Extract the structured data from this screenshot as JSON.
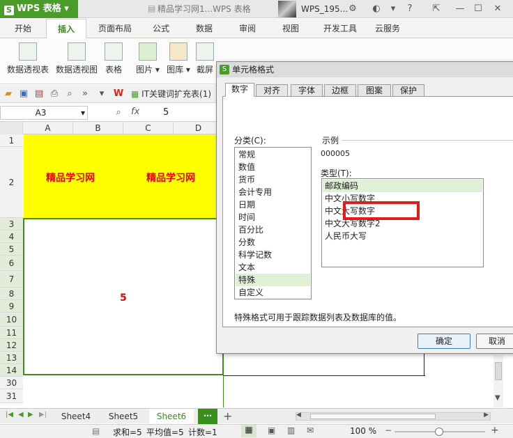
{
  "titlebar": {
    "app_name": "WPS 表格",
    "doc_title": "精品学习网1...WPS 表格",
    "user_name": "WPS_195..."
  },
  "ribbon_tabs": [
    "开始",
    "插入",
    "页面布局",
    "公式",
    "数据",
    "审阅",
    "视图",
    "开发工具",
    "云服务"
  ],
  "ribbon_buttons": [
    "数据透视表",
    "数据透视图",
    "表格",
    "图片",
    "图库",
    "截屏"
  ],
  "quickbar": {
    "file_tab": "IT关键词扩充表(1)"
  },
  "formula_bar": {
    "name_box": "A3",
    "fx": "fx",
    "value": "5"
  },
  "grid": {
    "columns": [
      "A",
      "B",
      "C",
      "D"
    ],
    "rows": [
      "1",
      "2",
      "3",
      "4",
      "5",
      "6",
      "7",
      "8",
      "9",
      "10",
      "11",
      "12",
      "13",
      "14",
      "30",
      "31"
    ],
    "cell_text_1": "精品学习网",
    "cell_text_2": "精品学习网",
    "merged_value": "5"
  },
  "dialog": {
    "title": "单元格格式",
    "tabs": [
      "数字",
      "对齐",
      "字体",
      "边框",
      "图案",
      "保护"
    ],
    "category_label": "分类(C):",
    "categories": [
      "常规",
      "数值",
      "货币",
      "会计专用",
      "日期",
      "时间",
      "百分比",
      "分数",
      "科学记数",
      "文本",
      "特殊",
      "自定义"
    ],
    "selected_category": "特殊",
    "sample_label": "示例",
    "sample_value": "000005",
    "type_label": "类型(T):",
    "types": [
      "邮政编码",
      "中文小写数字",
      "中文大写数字",
      "中文大写数字2",
      "人民币大写"
    ],
    "selected_type": "邮政编码",
    "description": "特殊格式可用于跟踪数据列表及数据库的值。",
    "ok": "确定",
    "cancel": "取消"
  },
  "sheet_tabs": [
    "Sheet4",
    "Sheet5",
    "Sheet6"
  ],
  "active_sheet": "Sheet6",
  "statusbar": {
    "sum": "求和=5",
    "avg": "平均值=5",
    "count": "计数=1",
    "zoom": "100 %"
  },
  "colors": {
    "accent": "#3a8f1c",
    "header_fill": "#ffff00",
    "highlight": "#e21b1b"
  }
}
